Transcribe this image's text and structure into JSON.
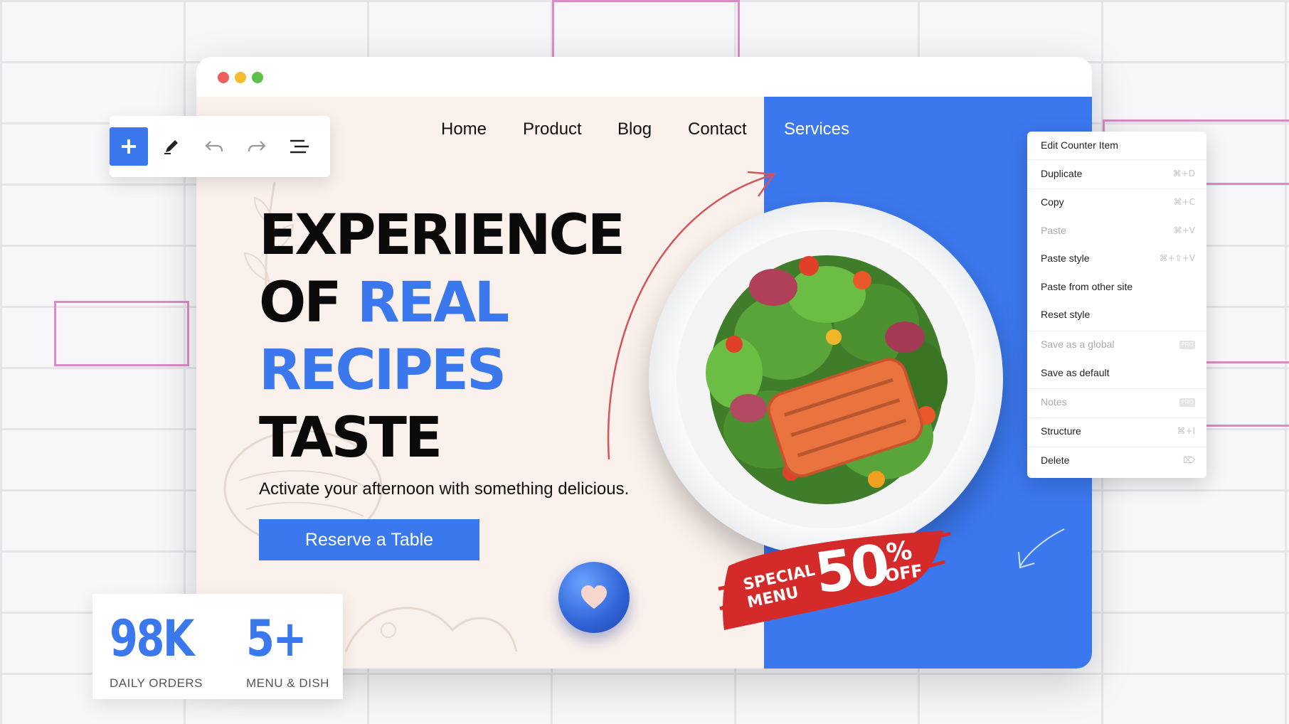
{
  "nav": {
    "items": [
      {
        "label": "Home"
      },
      {
        "label": "Product"
      },
      {
        "label": "Blog"
      },
      {
        "label": "Contact"
      },
      {
        "label": "Services"
      }
    ]
  },
  "hero": {
    "line1": "EXPERIENCE",
    "line2_a": "OF ",
    "line2_b": "REAL",
    "line3": "RECIPES",
    "line4": "TASTE",
    "subtitle": "Activate your afternoon with something delicious.",
    "cta_label": "Reserve a Table"
  },
  "promo": {
    "special": "SPECIAL",
    "menu": "MENU",
    "amount": "50",
    "percent": "%",
    "off": "OFF"
  },
  "stats": [
    {
      "value": "98K",
      "label": "DAILY ORDERS"
    },
    {
      "value": "5+",
      "label": "MENU & DISH"
    }
  ],
  "context_menu": {
    "items": [
      {
        "label": "Edit Counter Item",
        "shortcut": ""
      },
      {
        "label": "Duplicate",
        "shortcut": "⌘+D"
      },
      {
        "label": "Copy",
        "shortcut": "⌘+C"
      },
      {
        "label": "Paste",
        "shortcut": "⌘+V"
      },
      {
        "label": "Paste style",
        "shortcut": "⌘+⇧+V"
      },
      {
        "label": "Paste from other site",
        "shortcut": ""
      },
      {
        "label": "Reset style",
        "shortcut": ""
      },
      {
        "label": "Save as a global",
        "shortcut": "PRO"
      },
      {
        "label": "Save as default",
        "shortcut": ""
      },
      {
        "label": "Notes",
        "shortcut": "PRO"
      },
      {
        "label": "Structure",
        "shortcut": "⌘+I"
      },
      {
        "label": "Delete",
        "shortcut": "⌦"
      }
    ]
  },
  "colors": {
    "accent": "#3b78ee",
    "hero_bg": "#fbf1ec",
    "promo_red": "#d42a2a"
  },
  "icons": [
    "plus-icon",
    "pencil-icon",
    "undo-icon",
    "redo-icon",
    "navigator-icon",
    "heart-icon"
  ]
}
